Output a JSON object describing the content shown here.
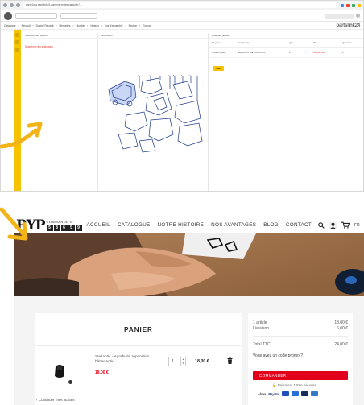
{
  "top_screenshot": {
    "address_bar": "parts4usa.partslink24.com/mercedes/partsinfo?...",
    "breadcrumbs": [
      "Catalogue",
      "Renault",
      "Dacia / Renault",
      "Mercedes",
      "Modèle",
      "Version",
      "Vue d'ensemble",
      "Section",
      "Groupe",
      "Sous-groupe"
    ],
    "brand": "partslink24",
    "left_panel_header": "Sélection des pièces",
    "left_panel_link": "Supprimer les sélections",
    "mid_panel_header": "Illustration",
    "right_panel_header": "Liste des pièces",
    "table_columns": [
      "N° pièce",
      "Désignation",
      "Qté",
      "Prix",
      "Quantité"
    ],
    "table_row": {
      "ref": "7701476698",
      "name": "SUPPORT DE FIXATION",
      "qty": "1",
      "status": "Disponible",
      "qty_val": "1"
    },
    "add_button": "Add"
  },
  "bottom_screenshot": {
    "logo": "RYP",
    "order_label": "COMMANDE N°",
    "order_digits": [
      "5",
      "8",
      "6",
      "5",
      "9"
    ],
    "nav_links": [
      "ACCUEIL",
      "CATALOGUE",
      "NOTRE HISTOIRE",
      "NOS AVANTAGES",
      "BLOG",
      "CONTACT"
    ],
    "lang": "FR",
    "cart": {
      "title": "PANIER",
      "product_name": "Stellantis - Agrafe de réparation bâtier Activ",
      "product_price": "18,00 €",
      "quantity": "1",
      "line_total": "18,00 €",
      "continue_link": "‹ Continuer mes achats"
    },
    "summary": {
      "items_label": "1 article",
      "items_value": "18,00 €",
      "shipping_label": "Livraison",
      "shipping_value": "6,00 €",
      "total_label": "Total TTC",
      "total_value": "24,00 €",
      "promo_label": "Vous avez un code promo ?",
      "order_button": "COMMANDER",
      "secure_label": "Paiement 100% sécurisé",
      "payment_brands": [
        "Alma",
        "PayPal"
      ]
    },
    "colors": {
      "accent_red": "#e3001b",
      "dark": "#222222"
    }
  },
  "decorations": {
    "arrow_color": "#f2b418",
    "yellow_strip": "#f6c300"
  }
}
